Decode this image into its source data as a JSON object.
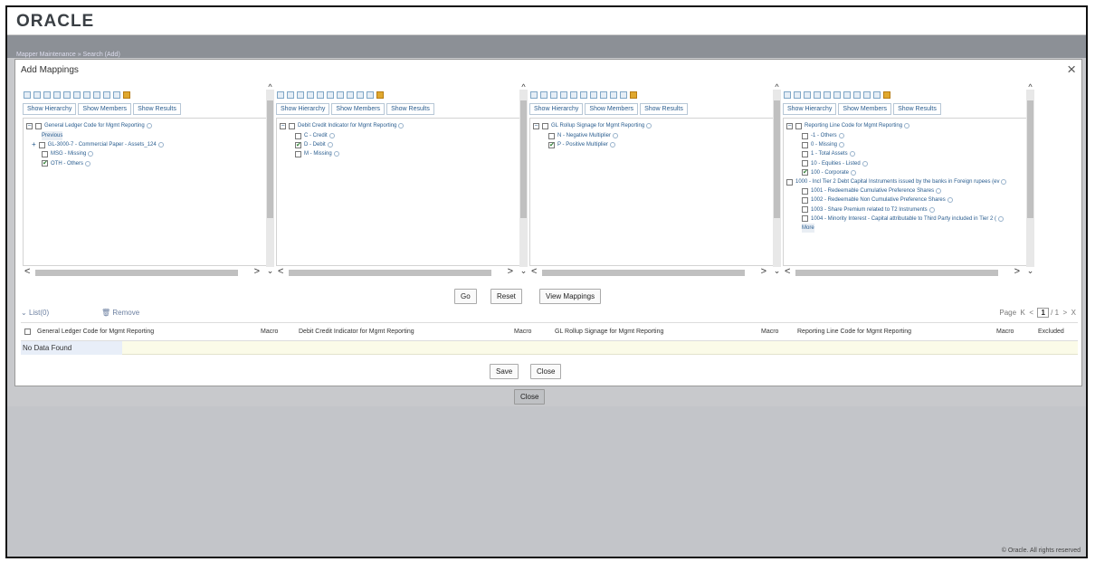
{
  "app": {
    "logo": "ORACLE",
    "footer": "© Oracle. All rights reserved"
  },
  "breadcrumb": "Mapper Maintenance  » Search  (Add)",
  "modal": {
    "title": "Add Mappings",
    "close_icon": "×"
  },
  "tabs": {
    "hierarchy": "Show Hierarchy",
    "members": "Show Members",
    "results": "Show Results"
  },
  "panels": [
    {
      "root": "General Ledger Code for Mgmt Reporting",
      "items": [
        {
          "label": "Previous",
          "type": "link"
        },
        {
          "label": "GL-3000-7 - Commercial Paper - Assets_124",
          "type": "expand",
          "checked": false
        },
        {
          "label": "MSG - Missing",
          "type": "leaf",
          "checked": false
        },
        {
          "label": "OTH - Others",
          "type": "leaf",
          "checked": true
        }
      ]
    },
    {
      "root": "Debit Credit Indicator for Mgmt Reporting",
      "items": [
        {
          "label": "C - Credit",
          "type": "leaf",
          "checked": false
        },
        {
          "label": "D - Debit",
          "type": "leaf",
          "checked": true
        },
        {
          "label": "M - Missing",
          "type": "leaf",
          "checked": false
        }
      ]
    },
    {
      "root": "GL Rollup Signage for Mgmt Reporting",
      "items": [
        {
          "label": "N - Negative Multiplier",
          "type": "leaf",
          "checked": false
        },
        {
          "label": "P - Positive Multiplier",
          "type": "leaf",
          "checked": true
        }
      ]
    },
    {
      "root": "Reporting Line Code for Mgmt Reporting",
      "items": [
        {
          "label": "-1 - Others",
          "type": "leaf",
          "checked": false
        },
        {
          "label": "0 - Missing",
          "type": "leaf",
          "checked": false
        },
        {
          "label": "1 - Total Assets",
          "type": "leaf",
          "checked": false
        },
        {
          "label": "10 - Equities - Listed",
          "type": "leaf",
          "checked": false
        },
        {
          "label": "100 - Corporate",
          "type": "leaf",
          "checked": true
        },
        {
          "label": "1000 - Incl Tier 2 Debt Capital Instruments issued by the banks in Foreign rupees (ev",
          "type": "level1",
          "checked": false
        },
        {
          "label": "1001 - Redeemable Cumulative Preference Shares",
          "type": "leaf",
          "checked": false
        },
        {
          "label": "1002 - Redeemable Non Cumulative Preference Shares",
          "type": "leaf",
          "checked": false
        },
        {
          "label": "1003 - Share Premium related to T2 Instruments",
          "type": "leaf",
          "checked": false
        },
        {
          "label": "1004 - Minority Interest - Capital attributable to Third Party included in Tier 2 (",
          "type": "leaf",
          "checked": false
        },
        {
          "label": "More",
          "type": "link"
        }
      ]
    }
  ],
  "actions": {
    "go": "Go",
    "reset": "Reset",
    "view_mappings": "View Mappings"
  },
  "list": {
    "label": "List(0)",
    "remove": "Remove"
  },
  "pager": {
    "label": "Page",
    "current": "1",
    "total": "/ 1"
  },
  "grid": {
    "columns": [
      "General Ledger Code for Mgmt Reporting",
      "Macro",
      "Debit Credit Indicator for Mgmt Reporting",
      "Macro",
      "GL Rollup Signage for Mgmt Reporting",
      "Macro",
      "Reporting Line Code for Mgmt Reporting",
      "Macro",
      "Excluded"
    ],
    "empty": "No Data Found"
  },
  "footer_buttons": {
    "save": "Save",
    "close": "Close"
  },
  "outer_close": "Close"
}
